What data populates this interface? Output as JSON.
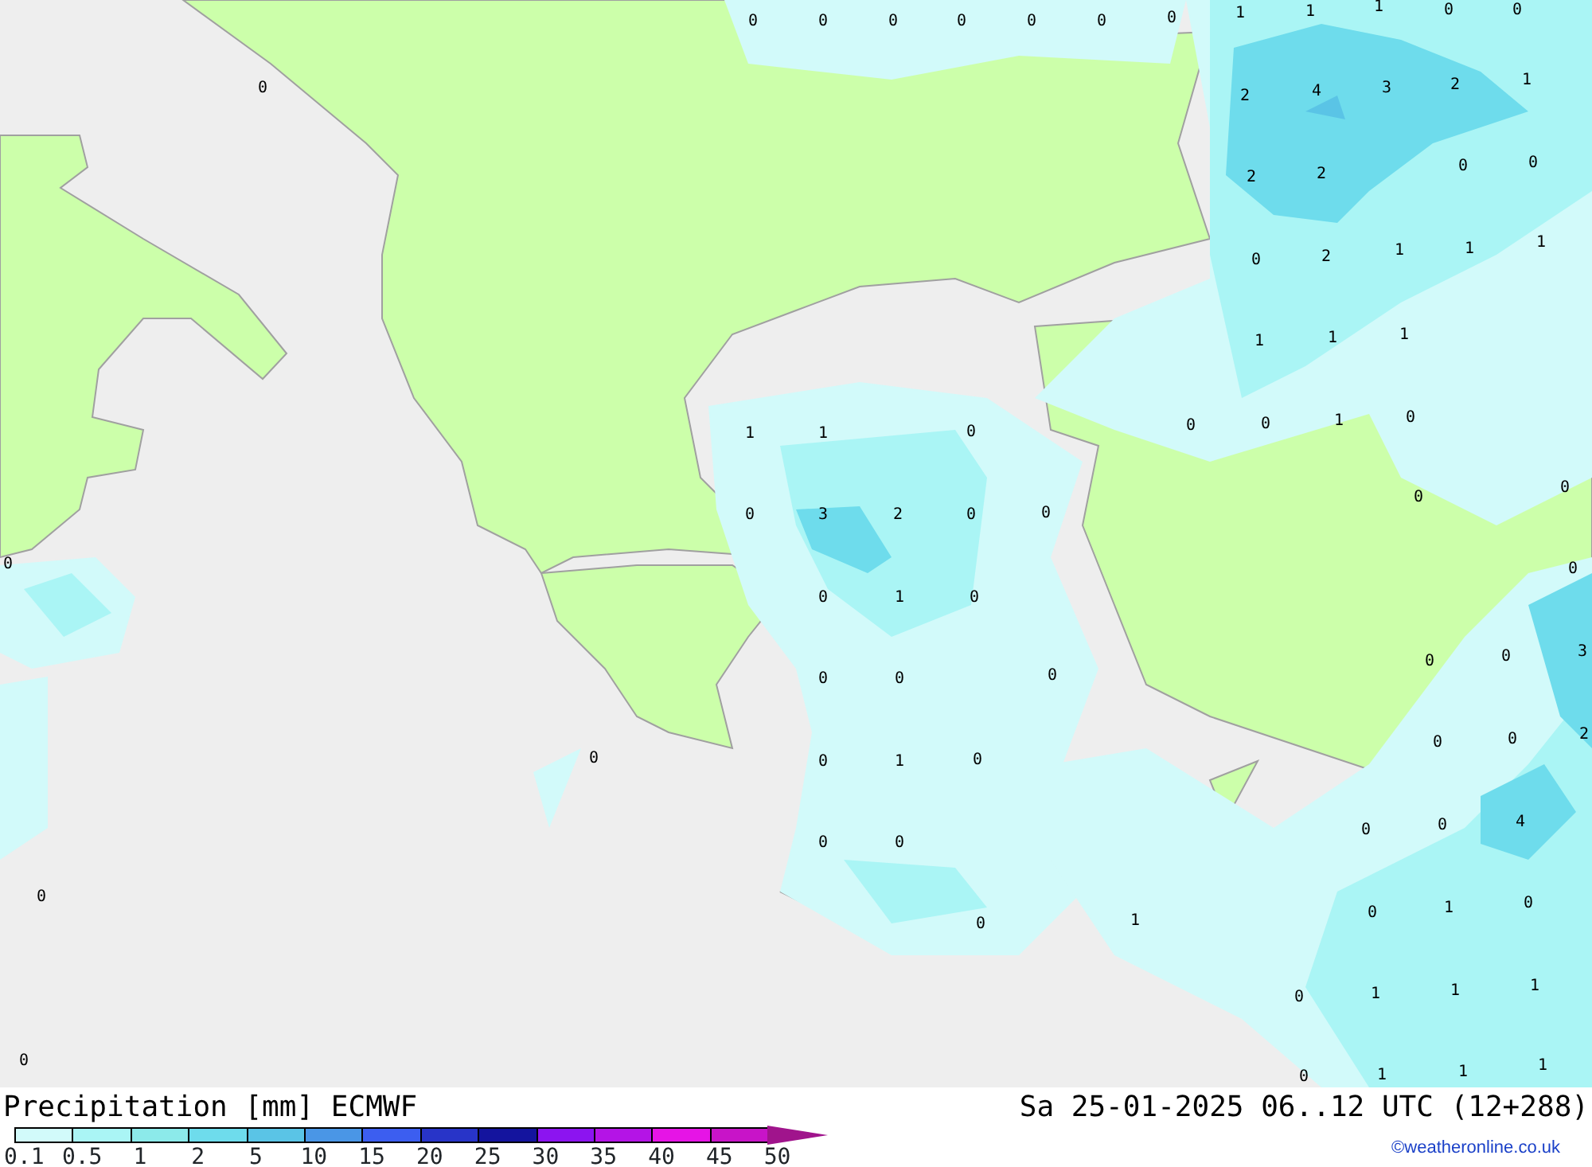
{
  "map": {
    "values": [
      "0",
      "0",
      "0",
      "0",
      "0",
      "0",
      "0",
      "1",
      "1",
      "1",
      "0",
      "0",
      "0",
      "2",
      "4",
      "3",
      "2",
      "1",
      "2",
      "2",
      "0",
      "0",
      "0",
      "2",
      "1",
      "1",
      "1",
      "1",
      "1",
      "1",
      "1",
      "1",
      "0",
      "0",
      "0",
      "1",
      "0",
      "0",
      "0",
      "0",
      "3",
      "2",
      "0",
      "0",
      "0",
      "0",
      "0",
      "1",
      "0",
      "0",
      "0",
      "3",
      "0",
      "0",
      "0",
      "0",
      "0",
      "2",
      "0",
      "0",
      "1",
      "0",
      "0",
      "0",
      "4",
      "0",
      "0",
      "0",
      "0",
      "1",
      "0",
      "1",
      "0",
      "0",
      "1",
      "1",
      "1",
      "0",
      "0",
      "1",
      "1",
      "1"
    ]
  },
  "legend": {
    "title": "Precipitation [mm] ECMWF",
    "timestamp": "Sa 25-01-2025 06..12 UTC (12+288)",
    "swatches": [
      {
        "color": "#d2fafa"
      },
      {
        "color": "#aaf5f5"
      },
      {
        "color": "#8ceaea"
      },
      {
        "color": "#6edcec"
      },
      {
        "color": "#5ac4e6"
      },
      {
        "color": "#4a96e6"
      },
      {
        "color": "#3c5ef0"
      },
      {
        "color": "#2834c8"
      },
      {
        "color": "#14149e"
      },
      {
        "color": "#8c14f0"
      },
      {
        "color": "#b414e6"
      },
      {
        "color": "#e614e6"
      },
      {
        "color": "#c814c8"
      }
    ],
    "arrow": {
      "color": "#a0148c"
    },
    "labels": [
      "0.1",
      "0.5",
      "1",
      "2",
      "5",
      "10",
      "15",
      "20",
      "25",
      "30",
      "35",
      "40",
      "45",
      "50"
    ],
    "credit": "©weatheronline.co.uk"
  }
}
